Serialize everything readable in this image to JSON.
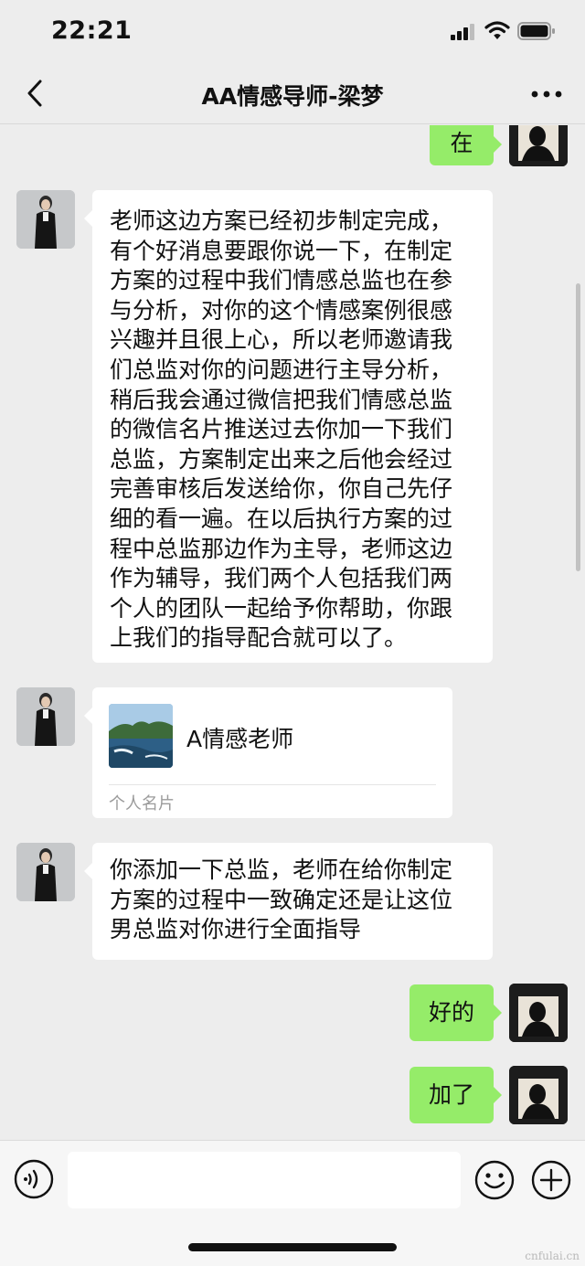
{
  "status_bar": {
    "time": "22:21"
  },
  "nav": {
    "title": "AA情感导师-梁梦",
    "back_icon": "chevron-left-icon",
    "more_icon": "ellipsis-icon"
  },
  "messages": [
    {
      "side": "out",
      "text": "在"
    },
    {
      "side": "in",
      "text": "老师这边方案已经初步制定完成，\n有个好消息要跟你说一下，在制定\n方案的过程中我们情感总监也在参\n与分析，对你的这个情感案例很感\n兴趣并且很上心，所以老师邀请我\n们总监对你的问题进行主导分析，\n稍后我会通过微信把我们情感总监\n的微信名片推送过去你加一下我们\n总监，方案制定出来之后他会经过\n完善审核后发送给你，你自己先仔\n细的看一遍。在以后执行方案的过\n程中总监那边作为主导，老师这边\n作为辅导，我们两个人包括我们两\n个人的团队一起给予你帮助，你跟\n上我们的指导配合就可以了。"
    },
    {
      "side": "in",
      "type": "contact_card",
      "name": "A情感老师",
      "label": "个人名片"
    },
    {
      "side": "in",
      "text": "你添加一下总监，老师在给你制定\n方案的过程中一致确定还是让这位\n男总监对你进行全面指导"
    },
    {
      "side": "out",
      "text": "好的"
    },
    {
      "side": "out",
      "text": "加了"
    }
  ],
  "input_bar": {
    "voice_icon": "voice-icon",
    "emoji_icon": "emoji-icon",
    "add_icon": "plus-circle-icon"
  },
  "colors": {
    "background": "#ededed",
    "outgoing_bubble": "#95ec69",
    "incoming_bubble": "#ffffff"
  },
  "watermark": "cnfulai.cn"
}
